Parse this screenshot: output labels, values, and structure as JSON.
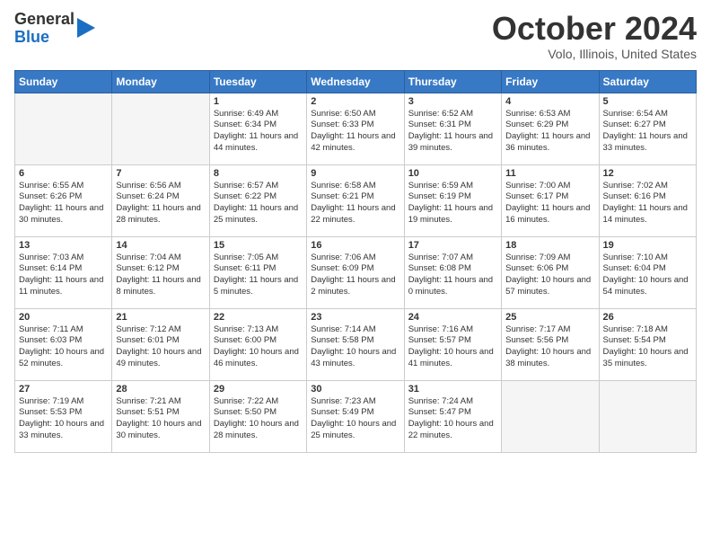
{
  "header": {
    "logo": {
      "line1": "General",
      "line2": "Blue"
    },
    "title": "October 2024",
    "location": "Volo, Illinois, United States"
  },
  "days_of_week": [
    "Sunday",
    "Monday",
    "Tuesday",
    "Wednesday",
    "Thursday",
    "Friday",
    "Saturday"
  ],
  "weeks": [
    [
      {
        "day": "",
        "info": ""
      },
      {
        "day": "",
        "info": ""
      },
      {
        "day": "1",
        "info": "Sunrise: 6:49 AM\nSunset: 6:34 PM\nDaylight: 11 hours\nand 44 minutes."
      },
      {
        "day": "2",
        "info": "Sunrise: 6:50 AM\nSunset: 6:33 PM\nDaylight: 11 hours\nand 42 minutes."
      },
      {
        "day": "3",
        "info": "Sunrise: 6:52 AM\nSunset: 6:31 PM\nDaylight: 11 hours\nand 39 minutes."
      },
      {
        "day": "4",
        "info": "Sunrise: 6:53 AM\nSunset: 6:29 PM\nDaylight: 11 hours\nand 36 minutes."
      },
      {
        "day": "5",
        "info": "Sunrise: 6:54 AM\nSunset: 6:27 PM\nDaylight: 11 hours\nand 33 minutes."
      }
    ],
    [
      {
        "day": "6",
        "info": "Sunrise: 6:55 AM\nSunset: 6:26 PM\nDaylight: 11 hours\nand 30 minutes."
      },
      {
        "day": "7",
        "info": "Sunrise: 6:56 AM\nSunset: 6:24 PM\nDaylight: 11 hours\nand 28 minutes."
      },
      {
        "day": "8",
        "info": "Sunrise: 6:57 AM\nSunset: 6:22 PM\nDaylight: 11 hours\nand 25 minutes."
      },
      {
        "day": "9",
        "info": "Sunrise: 6:58 AM\nSunset: 6:21 PM\nDaylight: 11 hours\nand 22 minutes."
      },
      {
        "day": "10",
        "info": "Sunrise: 6:59 AM\nSunset: 6:19 PM\nDaylight: 11 hours\nand 19 minutes."
      },
      {
        "day": "11",
        "info": "Sunrise: 7:00 AM\nSunset: 6:17 PM\nDaylight: 11 hours\nand 16 minutes."
      },
      {
        "day": "12",
        "info": "Sunrise: 7:02 AM\nSunset: 6:16 PM\nDaylight: 11 hours\nand 14 minutes."
      }
    ],
    [
      {
        "day": "13",
        "info": "Sunrise: 7:03 AM\nSunset: 6:14 PM\nDaylight: 11 hours\nand 11 minutes."
      },
      {
        "day": "14",
        "info": "Sunrise: 7:04 AM\nSunset: 6:12 PM\nDaylight: 11 hours\nand 8 minutes."
      },
      {
        "day": "15",
        "info": "Sunrise: 7:05 AM\nSunset: 6:11 PM\nDaylight: 11 hours\nand 5 minutes."
      },
      {
        "day": "16",
        "info": "Sunrise: 7:06 AM\nSunset: 6:09 PM\nDaylight: 11 hours\nand 2 minutes."
      },
      {
        "day": "17",
        "info": "Sunrise: 7:07 AM\nSunset: 6:08 PM\nDaylight: 11 hours\nand 0 minutes."
      },
      {
        "day": "18",
        "info": "Sunrise: 7:09 AM\nSunset: 6:06 PM\nDaylight: 10 hours\nand 57 minutes."
      },
      {
        "day": "19",
        "info": "Sunrise: 7:10 AM\nSunset: 6:04 PM\nDaylight: 10 hours\nand 54 minutes."
      }
    ],
    [
      {
        "day": "20",
        "info": "Sunrise: 7:11 AM\nSunset: 6:03 PM\nDaylight: 10 hours\nand 52 minutes."
      },
      {
        "day": "21",
        "info": "Sunrise: 7:12 AM\nSunset: 6:01 PM\nDaylight: 10 hours\nand 49 minutes."
      },
      {
        "day": "22",
        "info": "Sunrise: 7:13 AM\nSunset: 6:00 PM\nDaylight: 10 hours\nand 46 minutes."
      },
      {
        "day": "23",
        "info": "Sunrise: 7:14 AM\nSunset: 5:58 PM\nDaylight: 10 hours\nand 43 minutes."
      },
      {
        "day": "24",
        "info": "Sunrise: 7:16 AM\nSunset: 5:57 PM\nDaylight: 10 hours\nand 41 minutes."
      },
      {
        "day": "25",
        "info": "Sunrise: 7:17 AM\nSunset: 5:56 PM\nDaylight: 10 hours\nand 38 minutes."
      },
      {
        "day": "26",
        "info": "Sunrise: 7:18 AM\nSunset: 5:54 PM\nDaylight: 10 hours\nand 35 minutes."
      }
    ],
    [
      {
        "day": "27",
        "info": "Sunrise: 7:19 AM\nSunset: 5:53 PM\nDaylight: 10 hours\nand 33 minutes."
      },
      {
        "day": "28",
        "info": "Sunrise: 7:21 AM\nSunset: 5:51 PM\nDaylight: 10 hours\nand 30 minutes."
      },
      {
        "day": "29",
        "info": "Sunrise: 7:22 AM\nSunset: 5:50 PM\nDaylight: 10 hours\nand 28 minutes."
      },
      {
        "day": "30",
        "info": "Sunrise: 7:23 AM\nSunset: 5:49 PM\nDaylight: 10 hours\nand 25 minutes."
      },
      {
        "day": "31",
        "info": "Sunrise: 7:24 AM\nSunset: 5:47 PM\nDaylight: 10 hours\nand 22 minutes."
      },
      {
        "day": "",
        "info": ""
      },
      {
        "day": "",
        "info": ""
      }
    ]
  ]
}
